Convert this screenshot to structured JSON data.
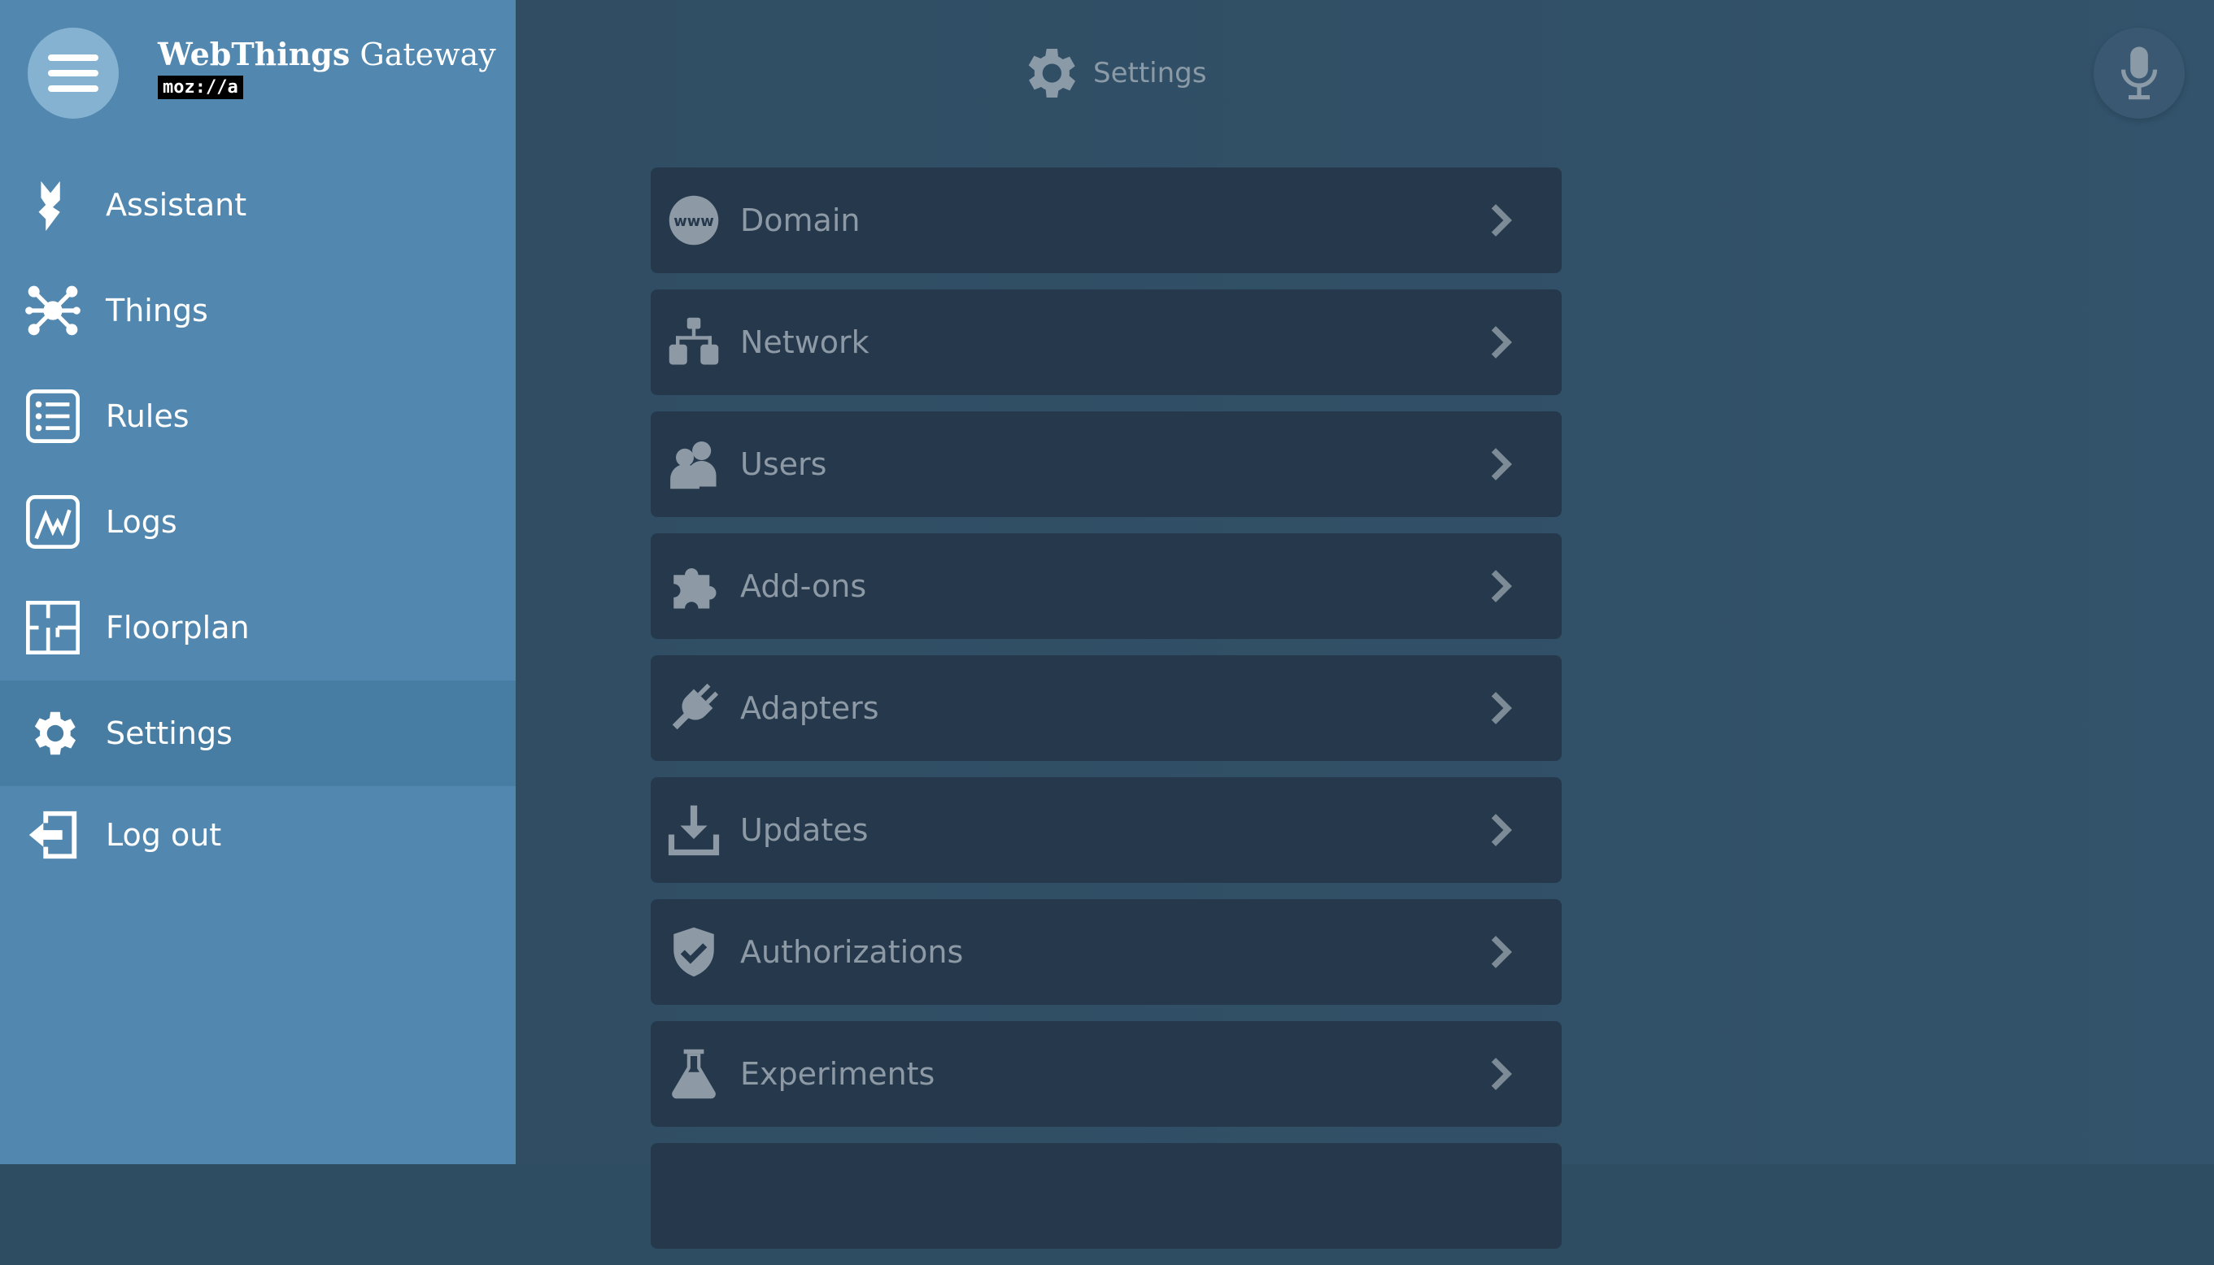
{
  "brand": {
    "name_bold": "WebThings",
    "name_light": " Gateway",
    "logo_text": "moz://a"
  },
  "header": {
    "title": "Settings"
  },
  "sidebar": {
    "items": [
      {
        "label": "Assistant",
        "icon": "assistant-icon"
      },
      {
        "label": "Things",
        "icon": "things-icon"
      },
      {
        "label": "Rules",
        "icon": "rules-icon"
      },
      {
        "label": "Logs",
        "icon": "logs-icon"
      },
      {
        "label": "Floorplan",
        "icon": "floorplan-icon"
      },
      {
        "label": "Settings",
        "icon": "gear-icon",
        "active": true
      },
      {
        "label": "Log out",
        "icon": "logout-icon"
      }
    ]
  },
  "settings": {
    "items": [
      {
        "label": "Domain",
        "icon": "www-icon"
      },
      {
        "label": "Network",
        "icon": "network-icon"
      },
      {
        "label": "Users",
        "icon": "users-icon"
      },
      {
        "label": "Add-ons",
        "icon": "puzzle-icon"
      },
      {
        "label": "Adapters",
        "icon": "plug-icon"
      },
      {
        "label": "Updates",
        "icon": "download-icon"
      },
      {
        "label": "Authorizations",
        "icon": "shield-icon"
      },
      {
        "label": "Experiments",
        "icon": "flask-icon"
      }
    ]
  },
  "colors": {
    "sidebar_bg": "#5288af",
    "sidebar_active": "#477ca3",
    "main_bg": "#2f4b60",
    "card_bg": "#26394c",
    "muted_text": "#8d9aa6"
  }
}
